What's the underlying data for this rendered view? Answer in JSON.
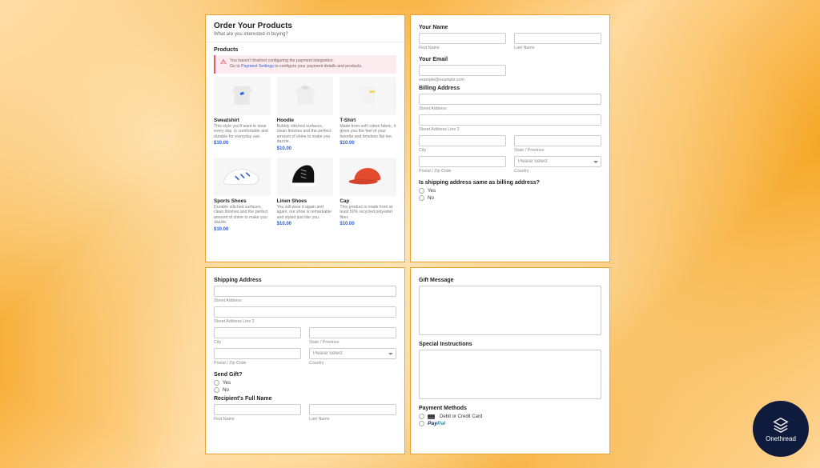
{
  "header": {
    "title": "Order Your Products",
    "subtitle": "What are you interested in buying?"
  },
  "products_label": "Products",
  "alert": {
    "line1": "You haven't finished configuring the payment integration.",
    "line2_prefix": "Go to ",
    "line2_link": "Payment Settings",
    "line2_rest": " to configure your payment details and products."
  },
  "products": [
    {
      "name": "Sweatshirt",
      "desc": "This style you'll want to wear every day. Is comfortable and durable for everyday use.",
      "price": "$10.00",
      "icon": "sweatshirt"
    },
    {
      "name": "Hoodie",
      "desc": "Bubbly stitched surfaces, clean finishes and the perfect amount of shine to make you dazzle.",
      "price": "$10.00",
      "icon": "hoodie"
    },
    {
      "name": "T-Shirt",
      "desc": "Made from soft cotton fabric, it gives you the feel of your favorite and timeless flat tee.",
      "price": "$10.00",
      "icon": "tshirt"
    },
    {
      "name": "Sports Shoes",
      "desc": "Durable stitched surfaces, clean finishes and the perfect amount of shine to make you dazzle.",
      "price": "$10.00",
      "icon": "sport-shoe"
    },
    {
      "name": "Linen Shoes",
      "desc": "You will wear it again and again, our shoe is remarkable and styled just like you.",
      "price": "$10.00",
      "icon": "linen-shoe"
    },
    {
      "name": "Cap",
      "desc": "This product is made from at least 50% recycled polyester fiber.",
      "price": "$10.00",
      "icon": "cap"
    }
  ],
  "right_top": {
    "your_name": "Your Name",
    "first_name": "First Name",
    "last_name": "Last Name",
    "your_email": "Your Email",
    "email_helper": "example@example.com",
    "billing_address": "Billing Address",
    "street_address": "Street Address",
    "street_address_2": "Street Address Line 2",
    "city": "City",
    "state": "State / Province",
    "postal": "Postal / Zip Code",
    "country": "Country",
    "please_select": "Please Select",
    "same_q": "Is shipping address same as billing address?",
    "yes": "Yes",
    "no": "No"
  },
  "left_bottom": {
    "shipping_address": "Shipping Address",
    "street_address": "Street Address",
    "street_address_2": "Street Address Line 2",
    "city": "City",
    "state": "State / Province",
    "postal": "Postal / Zip Code",
    "country": "Country",
    "please_select": "Please Select",
    "send_gift": "Send Gift?",
    "yes": "Yes",
    "no": "No",
    "recipient": "Recipient's Full Name",
    "first_name": "First Name",
    "last_name": "Last Name"
  },
  "right_bottom": {
    "gift_message": "Gift Message",
    "special_instructions": "Special Instructions",
    "payment_methods": "Payment Methods",
    "debit_cc": "Debit or Credit Card",
    "paypal1": "Pay",
    "paypal2": "Pal"
  },
  "brand": "Onethread"
}
